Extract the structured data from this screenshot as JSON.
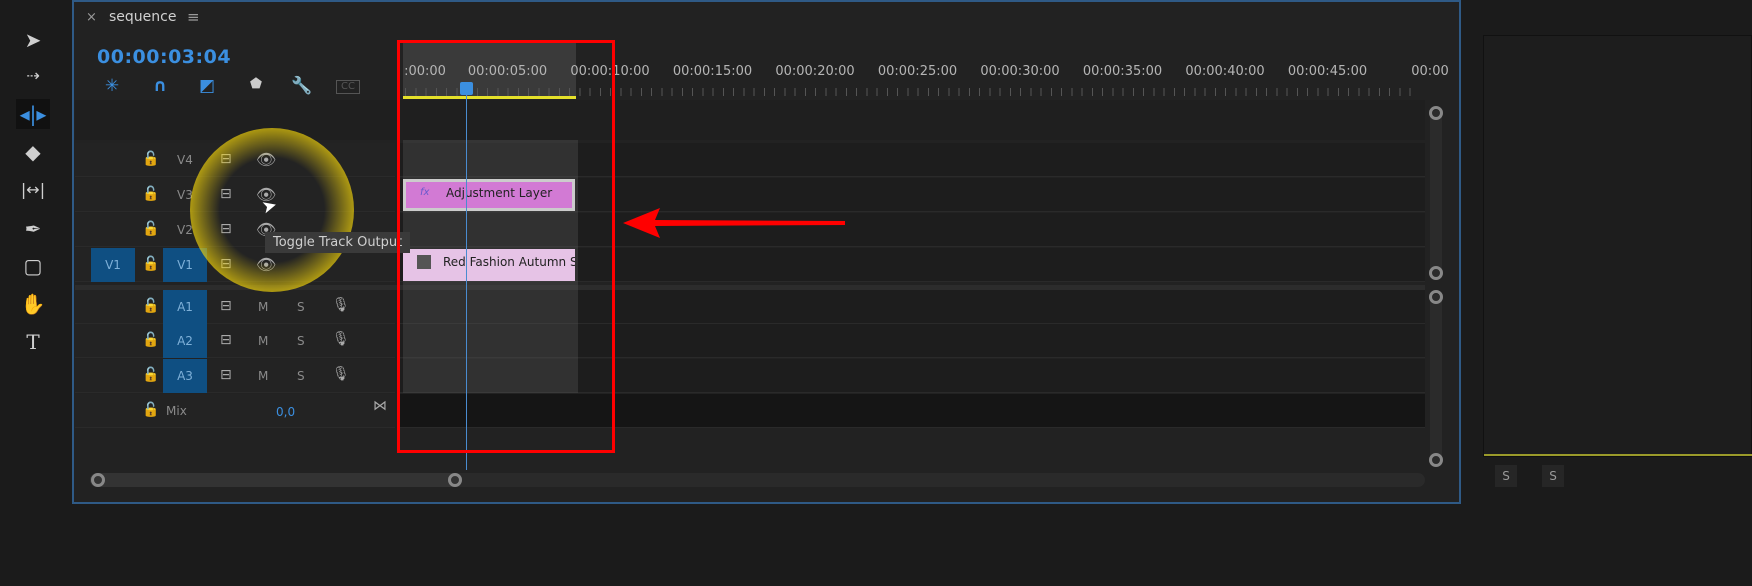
{
  "tools": [
    "selection-tool",
    "track-select-tool",
    "ripple-edit-tool",
    "razor-tool",
    "slip-tool",
    "pen-tool",
    "rectangle-tool",
    "hand-tool",
    "type-tool"
  ],
  "panel": {
    "close": "×",
    "title": "sequence",
    "menu": "≡",
    "timecode": "00:00:03:04",
    "cc_label": "CC"
  },
  "ruler": {
    "labels": [
      ":00:00",
      "00:00:05:00",
      "00:00:10:00",
      "00:00:15:00",
      "00:00:20:00",
      "00:00:25:00",
      "00:00:30:00",
      "00:00:35:00",
      "00:00:40:00",
      "00:00:45:00",
      "00:00"
    ]
  },
  "tracks": {
    "video": [
      {
        "name": "V4"
      },
      {
        "name": "V3"
      },
      {
        "name": "V2"
      },
      {
        "name": "V1",
        "source": "V1"
      }
    ],
    "audio": [
      {
        "name": "A1",
        "m": "M",
        "s": "S"
      },
      {
        "name": "A2",
        "m": "M",
        "s": "S"
      },
      {
        "name": "A3",
        "m": "M",
        "s": "S"
      }
    ],
    "mix": {
      "label": "Mix",
      "value": "0,0"
    }
  },
  "clips": {
    "adjustment": "Adjustment Layer",
    "video": "Red Fashion Autumn S",
    "fx": "fx"
  },
  "tooltip": "Toggle Track Output",
  "right_panel": {
    "s1": "S",
    "s2": "S"
  },
  "colors": {
    "accent": "#3b8fe0",
    "highlight": "#f5d60a",
    "annotation": "#ff0000",
    "adjustment_clip": "#d27ad4",
    "video_clip": "#e6c3e6"
  }
}
